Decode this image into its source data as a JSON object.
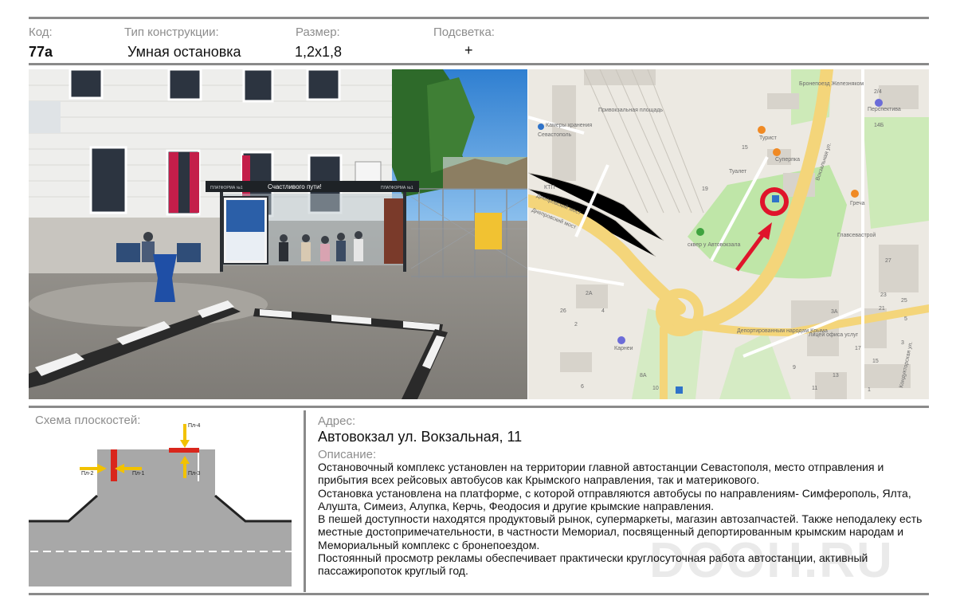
{
  "header": {
    "code_label": "Код:",
    "type_label": "Тип конструкции:",
    "size_label": "Размер:",
    "light_label": "Подсветка:",
    "code": "77а",
    "type": "Умная остановка",
    "size": "1,2х1,8",
    "light": "+"
  },
  "photo": {
    "shelter_banner": "Счастливого пути!",
    "shelter_tag_left": "ПЛАТФОРМА №1",
    "shelter_tag_right": "ПЛАТФОРМА №1"
  },
  "map": {
    "labels": {
      "street_vokzalnaya": "Вокзальная ул.",
      "bridge_1": "Днепровский мост",
      "bridge_2": "Днепровский мост",
      "square": "Привокзальная площадь",
      "sevastopol": "Севастополь",
      "kamery": "Камеры хранения",
      "ktp": "КТП",
      "tualet": "Туалет",
      "turist": "Турист",
      "suprtka": "Суперпка",
      "bronepoezd": "Бронепоезд Железняком",
      "perspektiva": "Перспектива",
      "grecha": "Греча",
      "glavsevastroy": "Главсевастрой",
      "skver": "сквер у Автовокзала",
      "karnei": "Карнеи",
      "deportirovannym": "Депортированным народам Крыма",
      "licey": "Лицей офиса услуг",
      "konduktorskaya": "Кондукторская ул.",
      "n2_4": "2/4",
      "n14b": "14Б",
      "n15": "15",
      "n19": "19",
      "n2a": "2А",
      "n26": "26",
      "n4": "4",
      "n2": "2",
      "n6": "6",
      "n8a": "8А",
      "n10": "10",
      "n3a": "3А",
      "n27": "27",
      "n21": "21",
      "n23": "23",
      "n25": "25",
      "n17": "17",
      "n15b": "15",
      "n13": "13",
      "n11": "11",
      "n9": "9",
      "n5": "5",
      "n3": "3",
      "n1": "1"
    }
  },
  "scheme": {
    "title": "Схема плоскостей:",
    "planes": [
      "Пл-1",
      "Пл-2",
      "Пл-3",
      "Пл-4"
    ]
  },
  "address": {
    "label": "Адрес:",
    "value": "Автовокзал ул. Вокзальная, 11"
  },
  "description": {
    "label": "Описание:",
    "p1": "Остановочный комплекс установлен на территории  главной автостанции Севастополя, место отправления и прибытия  всех рейсовых автобусов как Крымского направления, так и материкового.",
    "p2": " Остановка установлена на платформе, с которой отправляются автобусы по направлениям- Симферополь, Ялта, Алушта, Симеиз, Алупка, Керчь, Феодосия и другие крымские направления.",
    "p3": "В пешей доступности находятся продуктовый рынок, супермаркеты, магазин автозапчастей. Также неподалеку есть местные достопримечательности, в частности Мемориал, посвященный депортированным крымским народам и Мемориальный комплекс с бронепоездом.",
    "p4": "Постоянный  просмотр рекламы обеспечивает практически круглосуточная работа автостанции, активный пассажиропоток круглый год."
  },
  "watermark": "DOOH.RU",
  "colors": {
    "rule": "#8a8a8a",
    "label_gray": "#8d8d8d",
    "marker_red": "#e0142b",
    "road_yellow": "#f4d57a",
    "plane_red": "#d9261c",
    "plane_yellow": "#f2c200"
  }
}
